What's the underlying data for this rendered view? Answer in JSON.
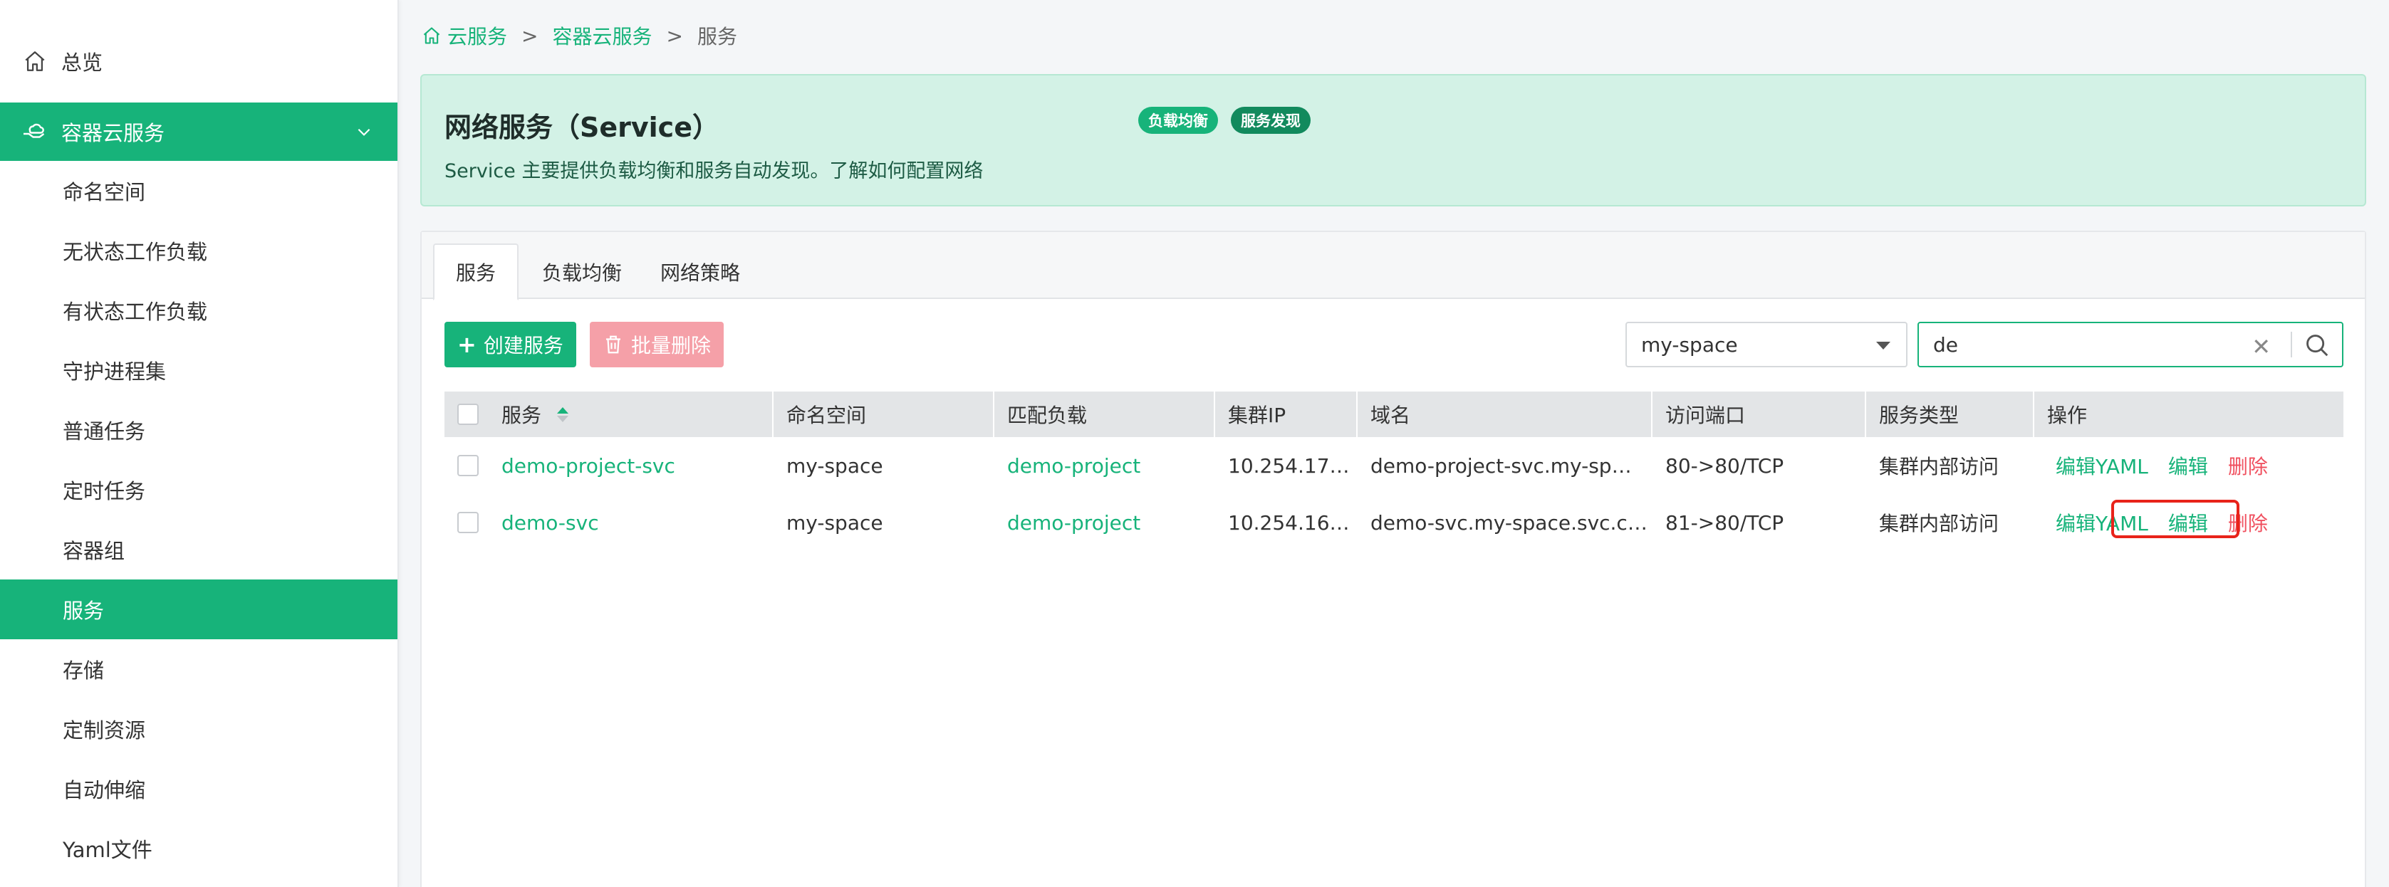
{
  "sidebar": {
    "overview": "总览",
    "group": "容器云服务",
    "items": [
      {
        "label": "命名空间",
        "active": false
      },
      {
        "label": "无状态工作负载",
        "active": false
      },
      {
        "label": "有状态工作负载",
        "active": false
      },
      {
        "label": "守护进程集",
        "active": false
      },
      {
        "label": "普通任务",
        "active": false
      },
      {
        "label": "定时任务",
        "active": false
      },
      {
        "label": "容器组",
        "active": false
      },
      {
        "label": "服务",
        "active": true
      },
      {
        "label": "存储",
        "active": false
      },
      {
        "label": "定制资源",
        "active": false
      },
      {
        "label": "自动伸缩",
        "active": false
      },
      {
        "label": "Yaml文件",
        "active": false
      }
    ]
  },
  "breadcrumb": {
    "root": "云服务",
    "sep1": ">",
    "parent": "容器云服务",
    "sep2": ">",
    "current": "服务"
  },
  "banner": {
    "title": "网络服务（Service）",
    "badge1": "负载均衡",
    "badge2": "服务发现",
    "description": "Service 主要提供负载均衡和服务自动发现。了解如何配置网络"
  },
  "tabs": [
    "服务",
    "负载均衡",
    "网络策略"
  ],
  "toolbar": {
    "create_label": "创建服务",
    "create_glyph": "+",
    "delete_label": "批量删除",
    "namespace_value": "my-space",
    "search_value": "de",
    "clear_glyph": "✕"
  },
  "table": {
    "headers": [
      "服务",
      "命名空间",
      "匹配负载",
      "集群IP",
      "域名",
      "访问端口",
      "服务类型",
      "操作"
    ],
    "rows": [
      {
        "name": "demo-project-svc",
        "namespace": "my-space",
        "workload": "demo-project",
        "cluster_ip": "10.254.17…",
        "domain": "demo-project-svc.my-sp…",
        "port": "80->80/TCP",
        "type": "集群内部访问",
        "op_yaml": "编辑YAML",
        "op_edit": "编辑",
        "op_delete": "删除"
      },
      {
        "name": "demo-svc",
        "namespace": "my-space",
        "workload": "demo-project",
        "cluster_ip": "10.254.16…",
        "domain": "demo-svc.my-space.svc.c…",
        "port": "81->80/TCP",
        "type": "集群内部访问",
        "op_yaml": "编辑YAML",
        "op_edit": "编辑",
        "op_delete": "删除"
      }
    ]
  },
  "colors": {
    "accent": "#17b37a",
    "danger": "#f0505f",
    "banner_bg": "#d3f2e6",
    "highlight": "#e8231a"
  }
}
